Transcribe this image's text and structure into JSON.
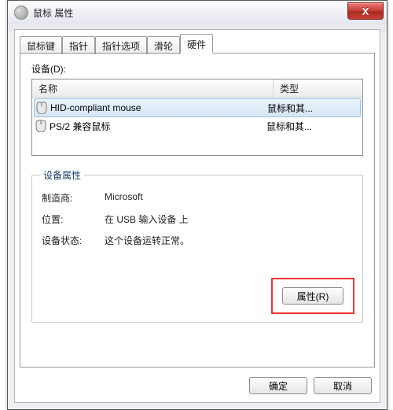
{
  "window": {
    "title": "鼠标 属性",
    "close_glyph": "X"
  },
  "tabs": {
    "0": {
      "label": "鼠标键"
    },
    "1": {
      "label": "指针"
    },
    "2": {
      "label": "指针选项"
    },
    "3": {
      "label": "滑轮"
    },
    "4": {
      "label": "硬件"
    }
  },
  "hardware": {
    "devices_label": "设备(D):",
    "columns": {
      "name": "名称",
      "type": "类型"
    },
    "rows": {
      "0": {
        "name": "HID-compliant mouse",
        "type": "鼠标和其..."
      },
      "1": {
        "name": "PS/2 兼容鼠标",
        "type": "鼠标和其..."
      }
    },
    "group": {
      "title": "设备属性",
      "manufacturer_label": "制造商:",
      "manufacturer_value": "Microsoft",
      "location_label": "位置:",
      "location_value": "在 USB 输入设备 上",
      "status_label": "设备状态:",
      "status_value": "这个设备运转正常。",
      "properties_button": "属性(R)"
    }
  },
  "buttons": {
    "ok": "确定",
    "cancel": "取消"
  }
}
